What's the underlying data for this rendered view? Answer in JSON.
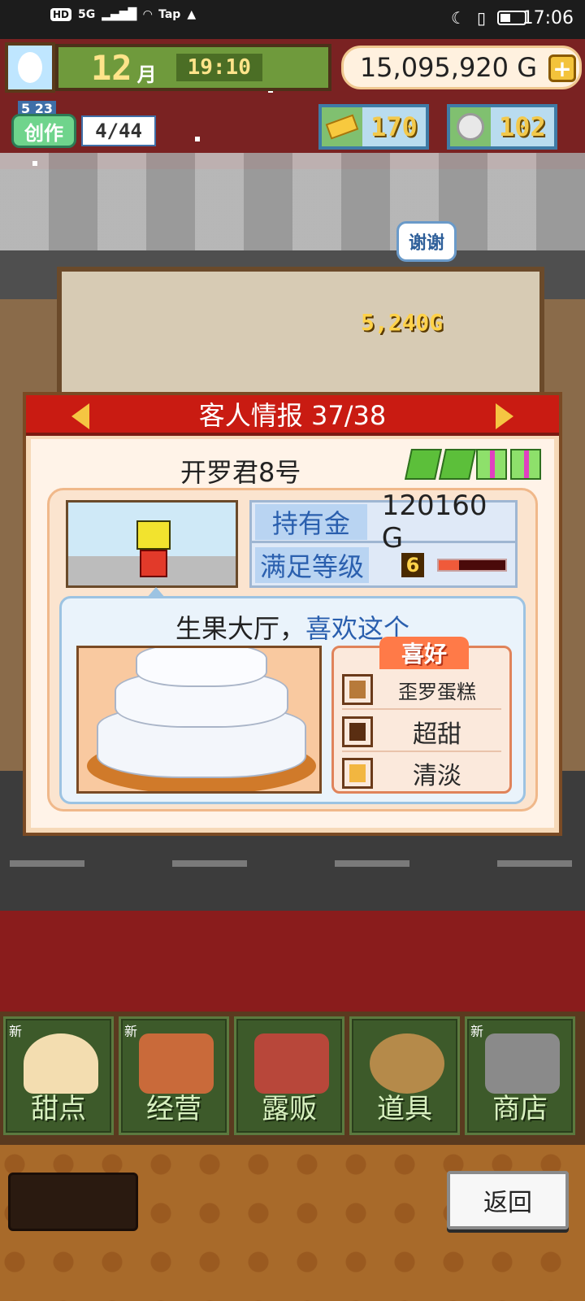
{
  "status_bar": {
    "left_chips": [
      "HD",
      "5G",
      "Tap"
    ],
    "time": "17:06"
  },
  "hud": {
    "month_number": "12",
    "month_label": "月",
    "clock": "19:10",
    "money": "15,095,920 G",
    "create": {
      "date": "5 23",
      "label": "创作",
      "count": "4/44"
    },
    "gold": "170",
    "silver": "102"
  },
  "scene": {
    "thanks_bubble": "谢谢",
    "earning": "5,240G"
  },
  "panel": {
    "title": "客人情报 37/38",
    "customer_name": "开罗君8号",
    "stats": {
      "money_label": "持有金",
      "money_value": "120160 G",
      "satisfaction_label": "满足等级",
      "satisfaction_level": "6",
      "satisfaction_fraction": 0.3
    },
    "speech": {
      "location": "生果大厅，",
      "likes": "喜欢这个"
    },
    "preferences": {
      "title": "喜好",
      "items": [
        "歪罗蛋糕",
        "超甜",
        "清淡"
      ]
    }
  },
  "menu": {
    "new_label": "新",
    "items": [
      "甜点",
      "经营",
      "露贩",
      "道具",
      "商店"
    ]
  },
  "back_button": "返回"
}
